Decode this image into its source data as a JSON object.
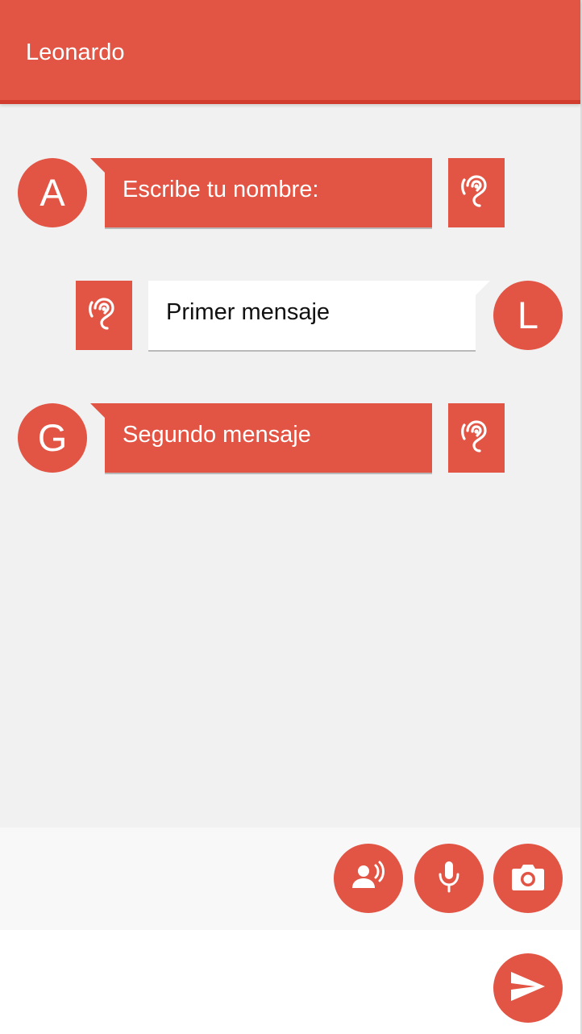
{
  "header": {
    "title": "Leonardo"
  },
  "messages": [
    {
      "sender": "bot",
      "avatar_letter": "A",
      "text": "Escribe tu nombre:",
      "listen_icon": "ear-icon"
    },
    {
      "sender": "user",
      "avatar_letter": "L",
      "text": "Primer mensaje",
      "listen_icon": "ear-icon"
    },
    {
      "sender": "bot",
      "avatar_letter": "G",
      "text": "Segundo mensaje",
      "listen_icon": "ear-icon"
    }
  ],
  "toolbar": {
    "buttons": [
      {
        "icon": "voice-speaker-icon"
      },
      {
        "icon": "microphone-icon"
      },
      {
        "icon": "camera-icon"
      }
    ]
  },
  "composer": {
    "value": "",
    "placeholder": "",
    "send_icon": "send-icon"
  },
  "colors": {
    "accent": "#e25444",
    "accent_dark": "#d13c2d",
    "background": "#f1f1f1",
    "toolbar_background": "#f8f8f8",
    "user_bubble": "#ffffff"
  }
}
